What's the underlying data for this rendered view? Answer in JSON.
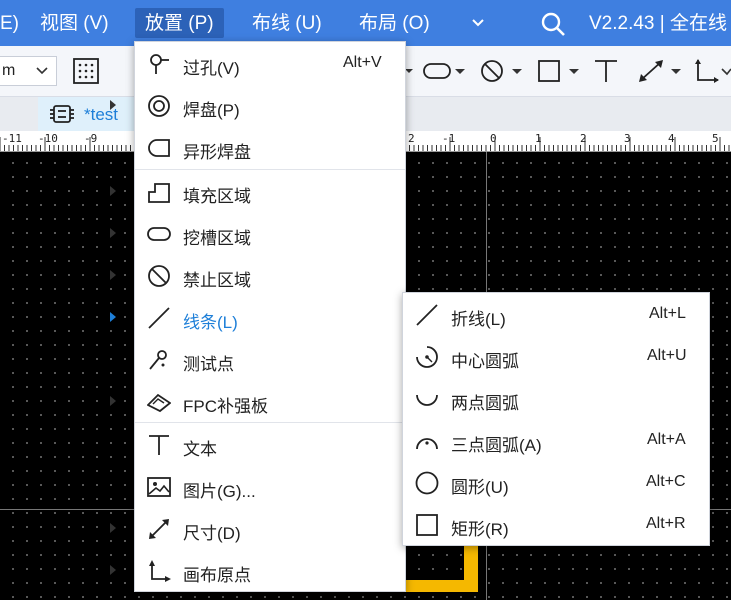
{
  "menubar": {
    "items": [
      "E)",
      "视图 (V)",
      "放置 (P)",
      "布线 (U)",
      "布局 (O)"
    ],
    "version": "V2.2.43 | 全在线"
  },
  "toolbar": {
    "unit_value": "m"
  },
  "tab": {
    "title": "*test"
  },
  "ruler": {
    "labels": [
      "-11",
      "-10",
      "-9",
      "2",
      "-1",
      "0",
      "1",
      "2",
      "3",
      "4",
      "5"
    ]
  },
  "place_menu": {
    "items": [
      {
        "label": "过孔(V)",
        "shortcut": "Alt+V",
        "icon": "via-icon"
      },
      {
        "label": "焊盘(P)",
        "icon": "pad-icon",
        "submenu": true
      },
      {
        "label": "异形焊盘",
        "icon": "custom-pad-icon"
      },
      {
        "label": "填充区域",
        "icon": "fill-region-icon",
        "submenu": true
      },
      {
        "label": "挖槽区域",
        "icon": "slot-region-icon",
        "submenu": true
      },
      {
        "label": "禁止区域",
        "icon": "keepout-icon",
        "submenu": true
      },
      {
        "label": "线条(L)",
        "icon": "line-icon",
        "submenu": true,
        "highlighted": true
      },
      {
        "label": "测试点",
        "icon": "test-point-icon"
      },
      {
        "label": "FPC补强板",
        "icon": "fpc-stiffener-icon",
        "submenu": true
      },
      {
        "label": "文本",
        "icon": "text-icon"
      },
      {
        "label": "图片(G)...",
        "icon": "image-icon"
      },
      {
        "label": "尺寸(D)",
        "icon": "dimension-icon",
        "submenu": true
      },
      {
        "label": "画布原点",
        "icon": "canvas-origin-icon",
        "submenu": true
      }
    ]
  },
  "line_submenu": {
    "items": [
      {
        "label": "折线(L)",
        "shortcut": "Alt+L",
        "icon": "polyline-icon"
      },
      {
        "label": "中心圆弧",
        "shortcut": "Alt+U",
        "icon": "center-arc-icon"
      },
      {
        "label": "两点圆弧",
        "shortcut": "",
        "icon": "two-point-arc-icon"
      },
      {
        "label": "三点圆弧(A)",
        "shortcut": "Alt+A",
        "icon": "three-point-arc-icon"
      },
      {
        "label": "圆形(U)",
        "shortcut": "Alt+C",
        "icon": "circle-icon"
      },
      {
        "label": "矩形(R)",
        "shortcut": "Alt+R",
        "icon": "rectangle-icon"
      }
    ]
  }
}
